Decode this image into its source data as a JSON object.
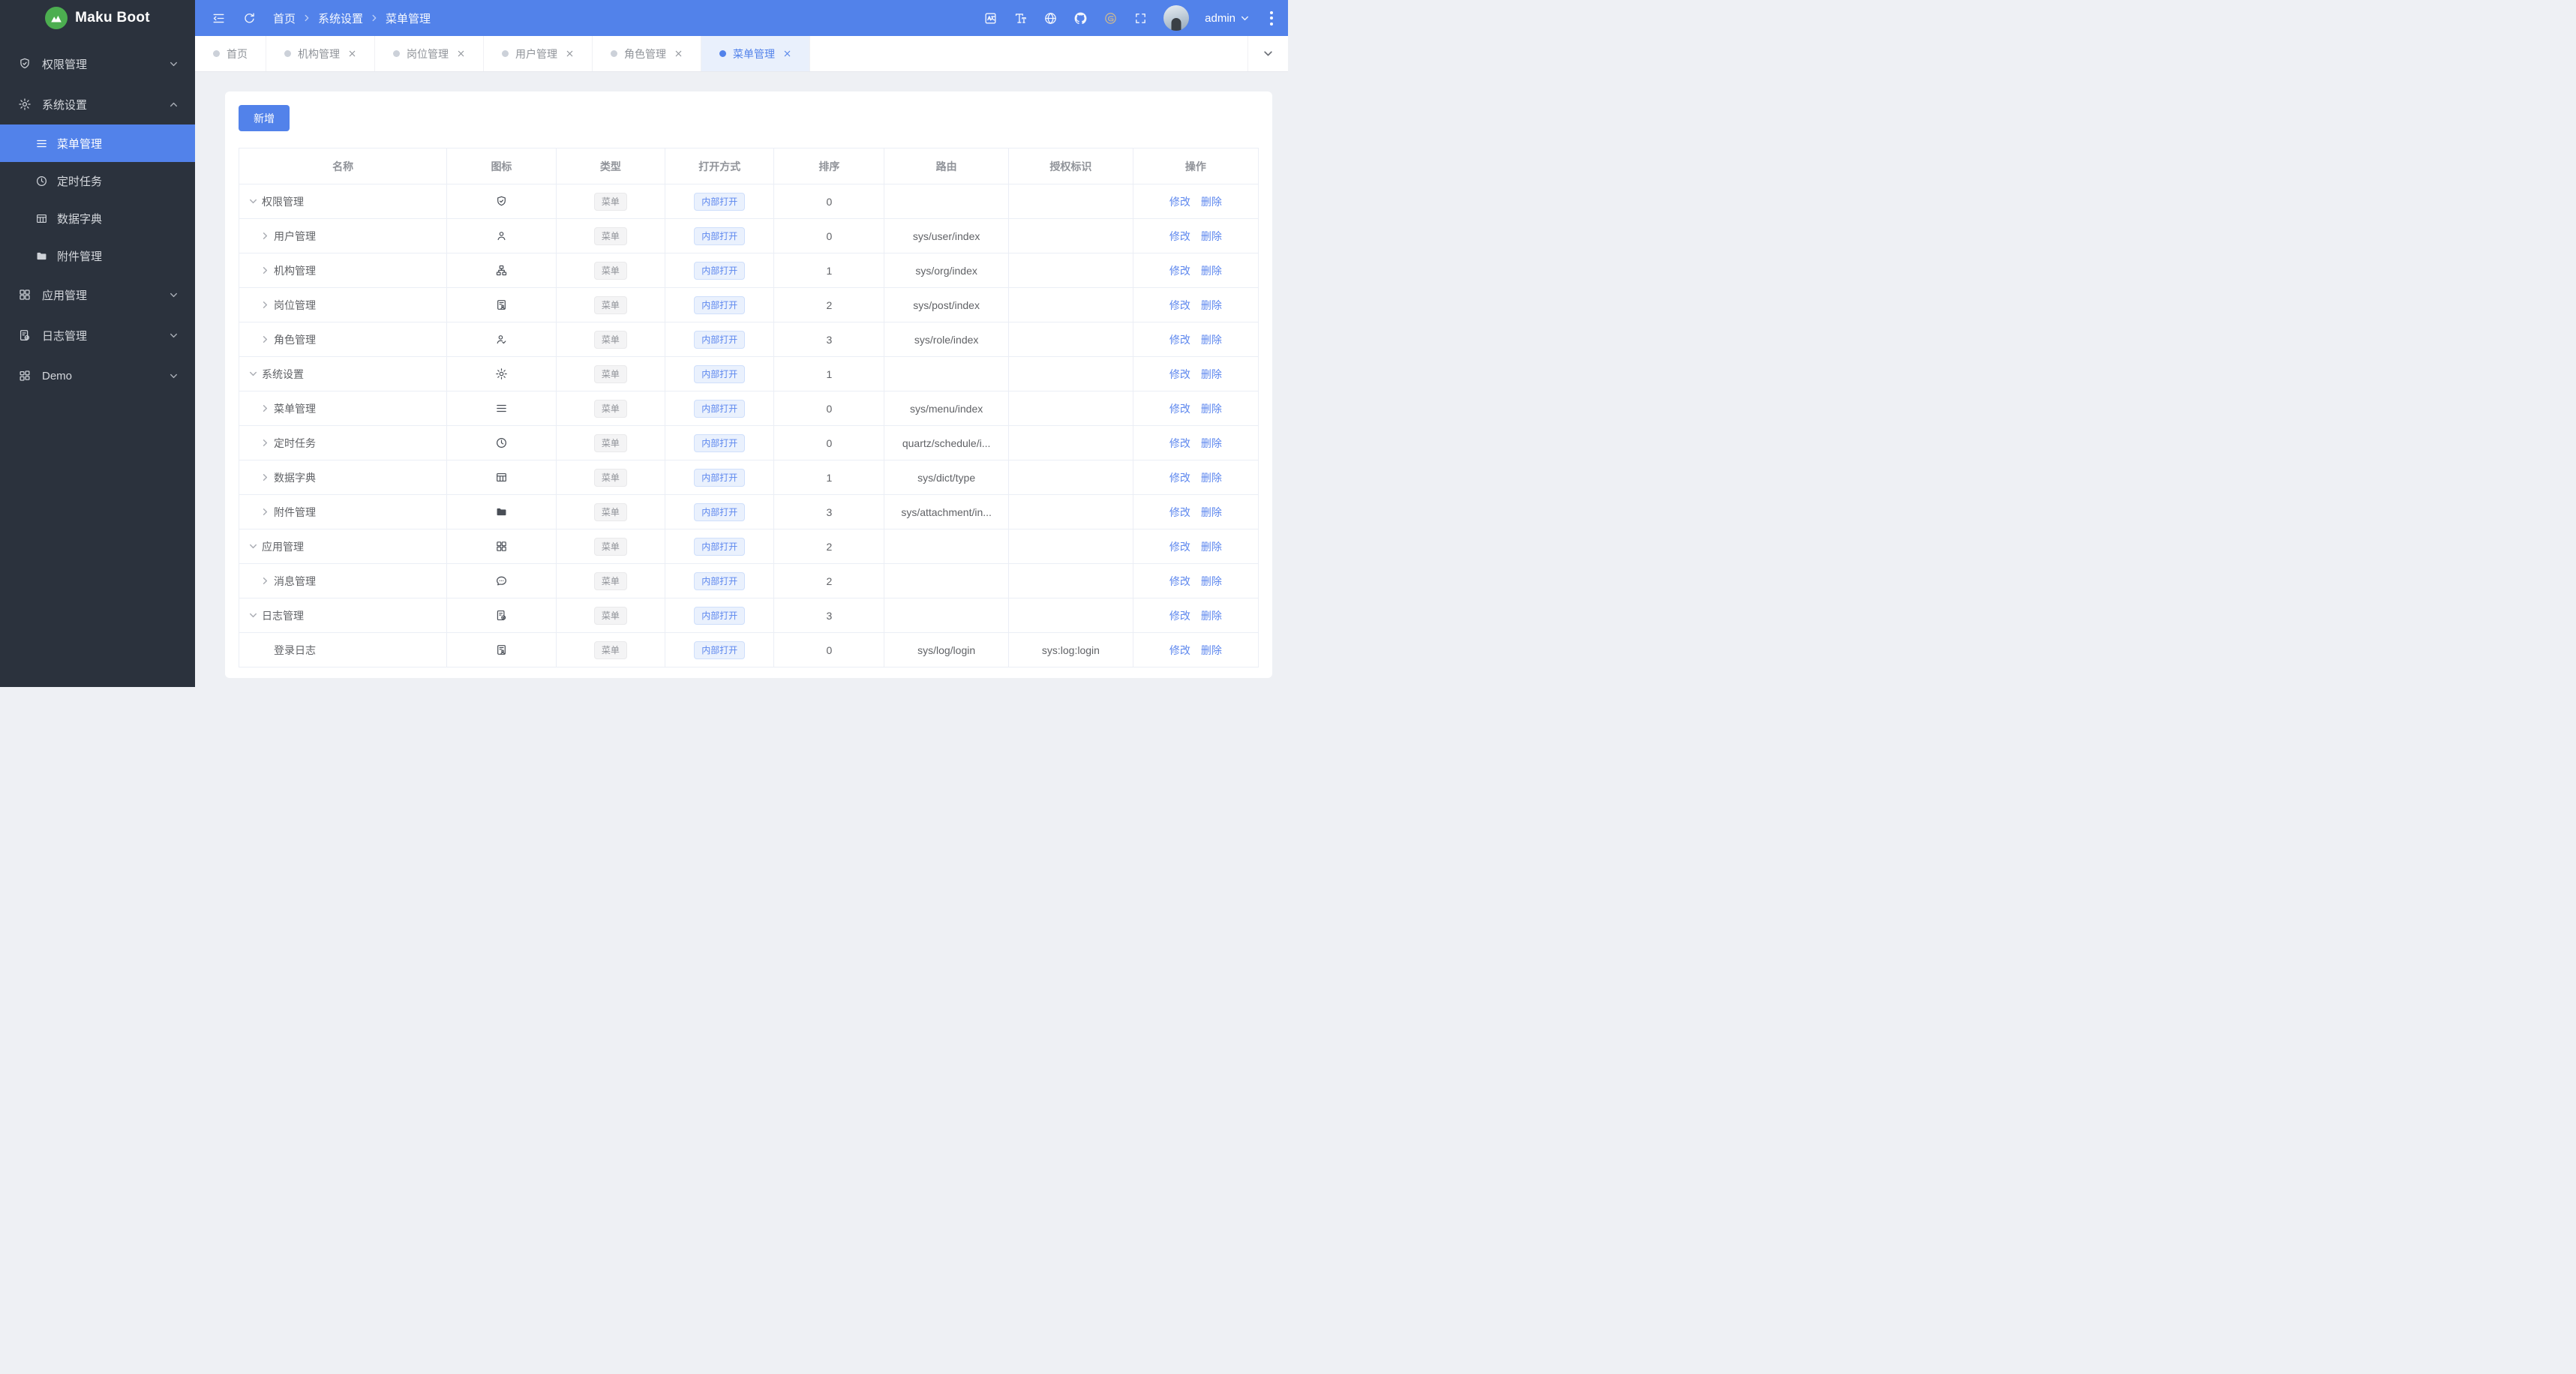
{
  "brand": {
    "name": "Maku Boot"
  },
  "colors": {
    "primary": "#5282ea",
    "link": "#5d87ee",
    "sidebar_bg": "#2b323d",
    "page_bg": "#eef0f4",
    "logo_green": "#4cae50",
    "active_tab_bg": "#e9f0fc",
    "tag_info_text": "#909399",
    "tag_open_bg": "#eaf1fd"
  },
  "topbar": {
    "left_icons": [
      "collapse-sidebar",
      "refresh"
    ],
    "breadcrumb": [
      "首页",
      "系统设置",
      "菜单管理"
    ],
    "right_icons": [
      "translate",
      "font-size",
      "globe",
      "github",
      "gitee",
      "fullscreen"
    ],
    "user": {
      "name": "admin"
    }
  },
  "sidebar": {
    "items": [
      {
        "label": "权限管理",
        "icon": "shield-check",
        "expanded": false
      },
      {
        "label": "系统设置",
        "icon": "gear",
        "expanded": true,
        "children": [
          {
            "label": "菜单管理",
            "icon": "menu",
            "active": true
          },
          {
            "label": "定时任务",
            "icon": "clock",
            "active": false
          },
          {
            "label": "数据字典",
            "icon": "dict",
            "active": false
          },
          {
            "label": "附件管理",
            "icon": "folder",
            "active": false
          }
        ]
      },
      {
        "label": "应用管理",
        "icon": "grid",
        "expanded": false
      },
      {
        "label": "日志管理",
        "icon": "log",
        "expanded": false
      },
      {
        "label": "Demo",
        "icon": "demo",
        "expanded": false
      }
    ]
  },
  "tabs": [
    {
      "label": "首页",
      "closable": false,
      "active": false
    },
    {
      "label": "机构管理",
      "closable": true,
      "active": false
    },
    {
      "label": "岗位管理",
      "closable": true,
      "active": false
    },
    {
      "label": "用户管理",
      "closable": true,
      "active": false
    },
    {
      "label": "角色管理",
      "closable": true,
      "active": false
    },
    {
      "label": "菜单管理",
      "closable": true,
      "active": true
    }
  ],
  "toolbar": {
    "add_label": "新增"
  },
  "table": {
    "columns": [
      "名称",
      "图标",
      "类型",
      "打开方式",
      "排序",
      "路由",
      "授权标识",
      "操作"
    ],
    "col_widths": [
      20.4,
      10.7,
      10.7,
      10.7,
      10.8,
      12.2,
      12.2,
      12.3
    ],
    "actions": {
      "edit": "修改",
      "delete": "删除"
    },
    "rows": [
      {
        "name": "权限管理",
        "level": 0,
        "expand": "down",
        "icon": "shield-check",
        "type": "菜单",
        "open": "内部打开",
        "sort": "0",
        "route": "",
        "perm": ""
      },
      {
        "name": "用户管理",
        "level": 1,
        "expand": "right",
        "icon": "user",
        "type": "菜单",
        "open": "内部打开",
        "sort": "0",
        "route": "sys/user/index",
        "perm": ""
      },
      {
        "name": "机构管理",
        "level": 1,
        "expand": "right",
        "icon": "org",
        "type": "菜单",
        "open": "内部打开",
        "sort": "1",
        "route": "sys/org/index",
        "perm": ""
      },
      {
        "name": "岗位管理",
        "level": 1,
        "expand": "right",
        "icon": "post",
        "type": "菜单",
        "open": "内部打开",
        "sort": "2",
        "route": "sys/post/index",
        "perm": ""
      },
      {
        "name": "角色管理",
        "level": 1,
        "expand": "right",
        "icon": "role",
        "type": "菜单",
        "open": "内部打开",
        "sort": "3",
        "route": "sys/role/index",
        "perm": ""
      },
      {
        "name": "系统设置",
        "level": 0,
        "expand": "down",
        "icon": "gear",
        "type": "菜单",
        "open": "内部打开",
        "sort": "1",
        "route": "",
        "perm": ""
      },
      {
        "name": "菜单管理",
        "level": 1,
        "expand": "right",
        "icon": "menu",
        "type": "菜单",
        "open": "内部打开",
        "sort": "0",
        "route": "sys/menu/index",
        "perm": ""
      },
      {
        "name": "定时任务",
        "level": 1,
        "expand": "right",
        "icon": "clock",
        "type": "菜单",
        "open": "内部打开",
        "sort": "0",
        "route": "quartz/schedule/i...",
        "perm": ""
      },
      {
        "name": "数据字典",
        "level": 1,
        "expand": "right",
        "icon": "dict",
        "type": "菜单",
        "open": "内部打开",
        "sort": "1",
        "route": "sys/dict/type",
        "perm": ""
      },
      {
        "name": "附件管理",
        "level": 1,
        "expand": "right",
        "icon": "folder",
        "type": "菜单",
        "open": "内部打开",
        "sort": "3",
        "route": "sys/attachment/in...",
        "perm": ""
      },
      {
        "name": "应用管理",
        "level": 0,
        "expand": "down",
        "icon": "grid",
        "type": "菜单",
        "open": "内部打开",
        "sort": "2",
        "route": "",
        "perm": ""
      },
      {
        "name": "消息管理",
        "level": 1,
        "expand": "right",
        "icon": "message",
        "type": "菜单",
        "open": "内部打开",
        "sort": "2",
        "route": "",
        "perm": ""
      },
      {
        "name": "日志管理",
        "level": 0,
        "expand": "down",
        "icon": "log",
        "type": "菜单",
        "open": "内部打开",
        "sort": "3",
        "route": "",
        "perm": ""
      },
      {
        "name": "登录日志",
        "level": 1,
        "expand": "none",
        "icon": "post",
        "type": "菜单",
        "open": "内部打开",
        "sort": "0",
        "route": "sys/log/login",
        "perm": "sys:log:login"
      }
    ]
  }
}
